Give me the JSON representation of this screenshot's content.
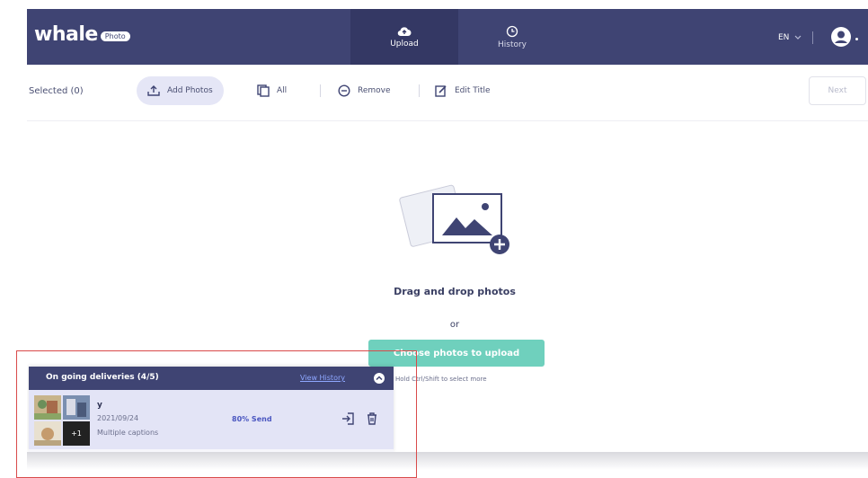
{
  "app": {
    "logo_text": "whale",
    "logo_badge": "Photo"
  },
  "nav": {
    "tabs": [
      {
        "label": "Upload",
        "icon": "cloud-upload-icon",
        "active": true
      },
      {
        "label": "History",
        "icon": "clock-icon",
        "active": false
      }
    ],
    "language": "EN"
  },
  "toolbar": {
    "selected_label": "Selected (0)",
    "add_photos_label": "Add Photos",
    "all_label": "All",
    "remove_label": "Remove",
    "edit_title_label": "Edit Title",
    "next_label": "Next"
  },
  "dropzone": {
    "drag_text": "Drag and drop photos",
    "or_text": "or",
    "choose_label": "Choose photos to upload",
    "hint": "Hold Ctrl/Shift to select more"
  },
  "deliveries": {
    "title": "On going deliveries (4/5)",
    "view_history_label": "View History",
    "items": [
      {
        "name": "y",
        "date": "2021/09/24",
        "caption": "Multiple captions",
        "progress": "80% Send",
        "more_count": "+1"
      }
    ]
  },
  "colors": {
    "header_bg": "#3f4473",
    "accent_teal": "#6fd0bd",
    "pill_bg": "#e5e6f6",
    "annotation_red": "#d94a4a"
  }
}
